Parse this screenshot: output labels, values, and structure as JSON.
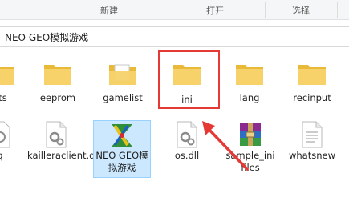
{
  "ribbon": {
    "groups": [
      "新建",
      "打开",
      "选择"
    ]
  },
  "address": {
    "path": "NEO GEO模拟游戏"
  },
  "files_row1": [
    {
      "name": "ats",
      "type": "folder"
    },
    {
      "name": "eeprom",
      "type": "folder"
    },
    {
      "name": "gamelist",
      "type": "folder-doc"
    },
    {
      "name": "ini",
      "type": "folder",
      "highlighted": true
    },
    {
      "name": "lang",
      "type": "folder"
    },
    {
      "name": "recinput",
      "type": "folder"
    }
  ],
  "files_row2": [
    {
      "name": "q",
      "type": "dll"
    },
    {
      "name": "kailleraclient.dll",
      "type": "dll"
    },
    {
      "name": "NEO GEO模拟游戏",
      "type": "exe",
      "selected": true
    },
    {
      "name": "os.dll",
      "type": "dll"
    },
    {
      "name": "sample_ini files",
      "type": "rar"
    },
    {
      "name": "whatsnew",
      "type": "txt"
    }
  ],
  "colors": {
    "highlight_box": "#e53935",
    "selection": "#cce8ff",
    "folder": "#f5c74a"
  }
}
